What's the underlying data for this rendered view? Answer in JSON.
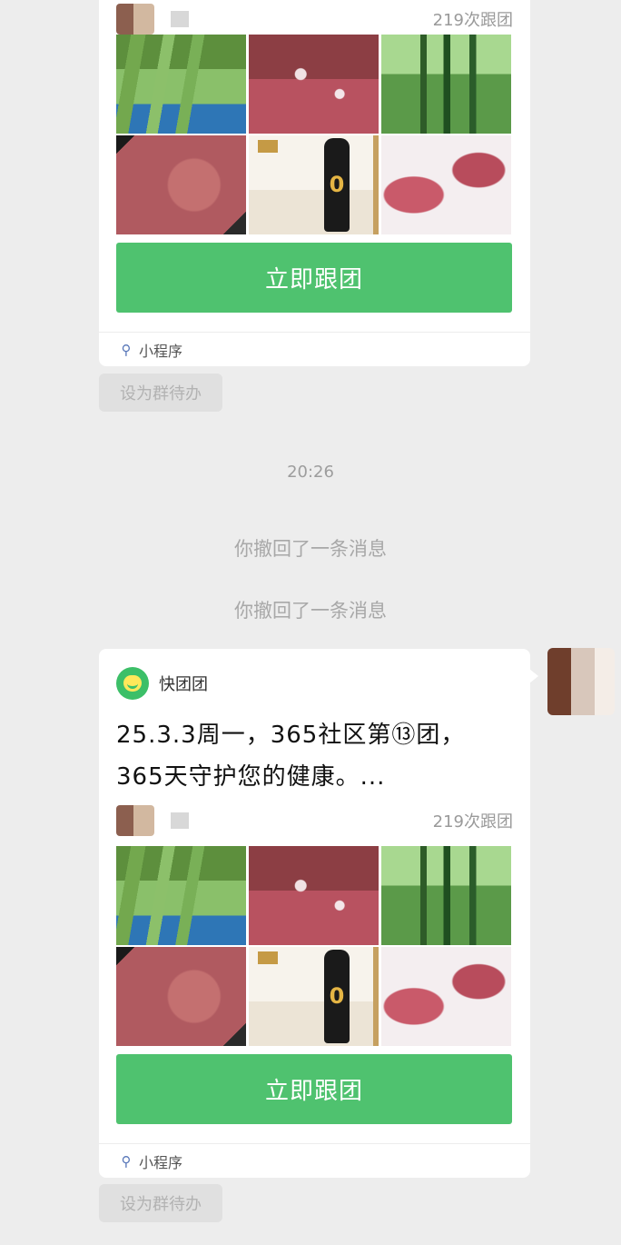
{
  "colors": {
    "background": "#ededed",
    "cta_green": "#4fc26f",
    "card": "#ffffff",
    "app_logo": "#3cbf68"
  },
  "cards": [
    {
      "count_label": "219次跟团",
      "cta_label": "立即跟团",
      "footer_label": "小程序",
      "todo_label": "设为群待办"
    },
    {
      "app_name": "快团团",
      "title_line1": "25.3.3周一，365社区第⑬团，",
      "title_line2": "365天守护您的健康。...",
      "count_label": "219次跟团",
      "cta_label": "立即跟团",
      "footer_label": "小程序",
      "todo_label": "设为群待办"
    }
  ],
  "timestamp": "20:26",
  "system_messages": [
    "你撤回了一条消息",
    "你撤回了一条消息"
  ],
  "product_images": [
    "greens",
    "beef-slices",
    "cucumbers",
    "beef-chunk",
    "soy-sauce-bottle",
    "beef-shank"
  ],
  "icons": {
    "mini_program": "link-icon"
  }
}
